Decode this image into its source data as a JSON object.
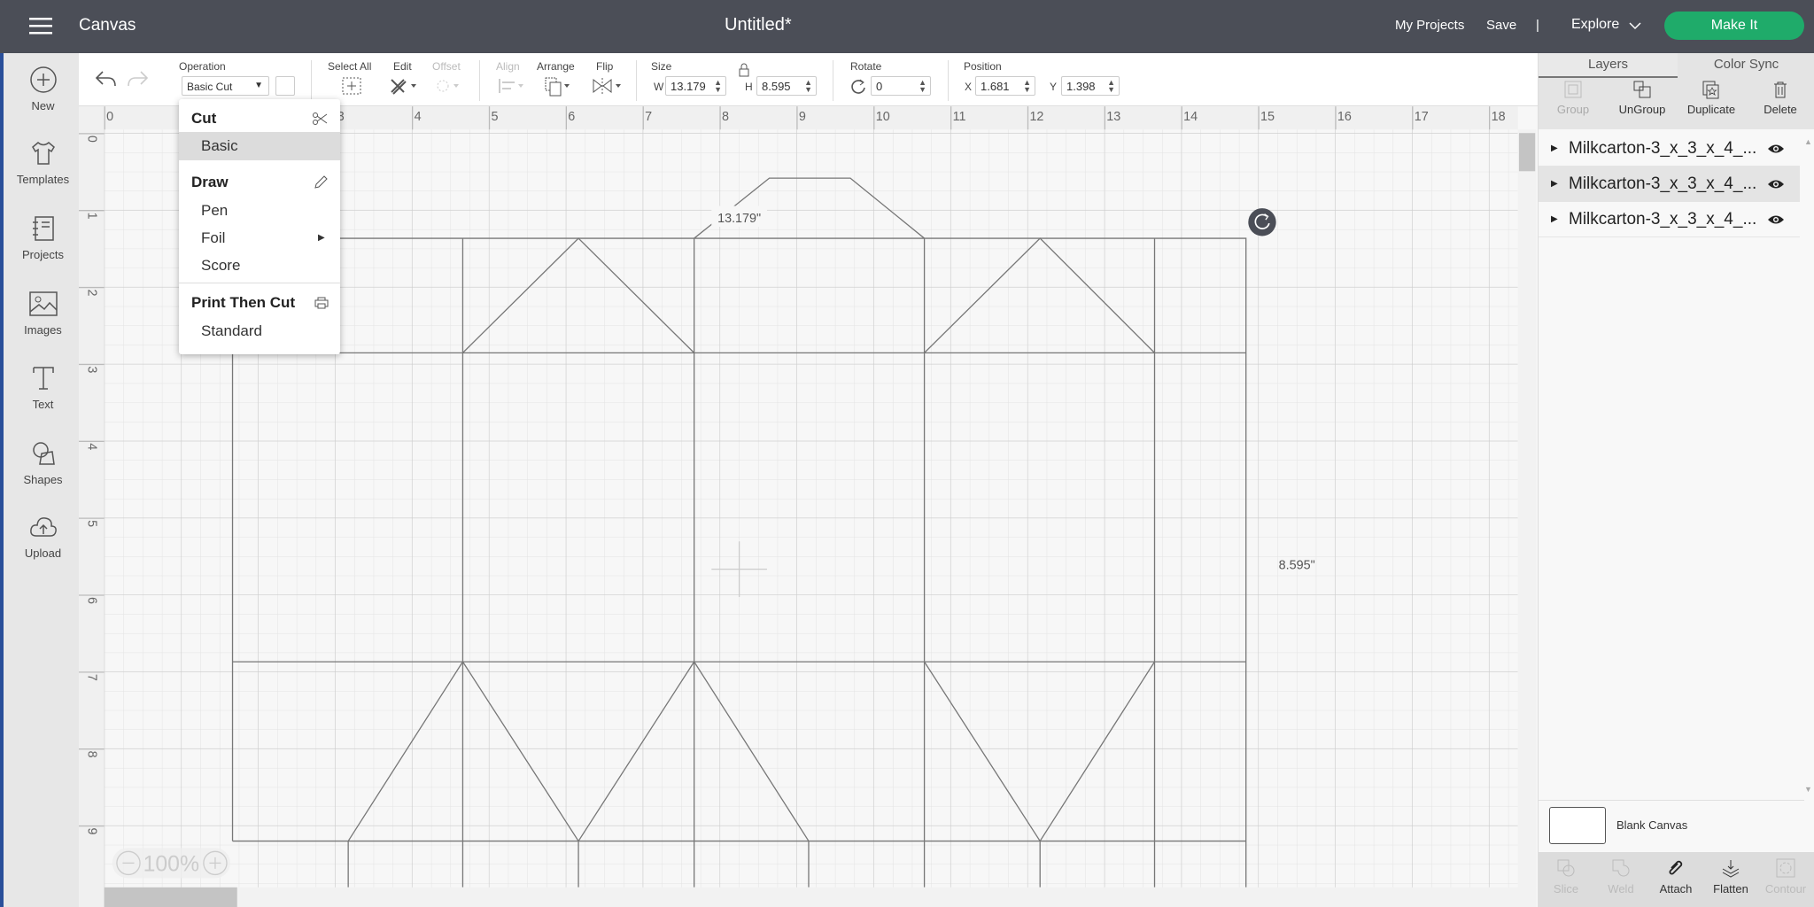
{
  "topbar": {
    "menu_icon": "hamburger-icon",
    "app_title": "Canvas",
    "doc_title": "Untitled*",
    "my_projects": "My Projects",
    "save": "Save",
    "divider": "|",
    "explore": "Explore",
    "make_it": "Make It",
    "make_it_color": "#1fab6a"
  },
  "sidebar": {
    "items": [
      {
        "label": "New",
        "icon": "plus-circle-icon"
      },
      {
        "label": "Templates",
        "icon": "shirt-icon"
      },
      {
        "label": "Projects",
        "icon": "notebook-icon"
      },
      {
        "label": "Images",
        "icon": "image-icon"
      },
      {
        "label": "Text",
        "icon": "text-icon"
      },
      {
        "label": "Shapes",
        "icon": "shapes-icon"
      },
      {
        "label": "Upload",
        "icon": "cloud-upload-icon"
      }
    ]
  },
  "toolbar": {
    "operation_label": "Operation",
    "operation_value": "Basic Cut",
    "select_all": "Select All",
    "edit": "Edit",
    "offset": "Offset",
    "align": "Align",
    "arrange": "Arrange",
    "flip": "Flip",
    "size": "Size",
    "w_label": "W",
    "w_value": "13.179",
    "h_label": "H",
    "h_value": "8.595",
    "rotate": "Rotate",
    "rotate_value": "0",
    "position": "Position",
    "x_label": "X",
    "x_value": "1.681",
    "y_label": "Y",
    "y_value": "1.398"
  },
  "operation_menu": {
    "cut": "Cut",
    "basic": "Basic",
    "draw": "Draw",
    "pen": "Pen",
    "foil": "Foil",
    "score": "Score",
    "print_then_cut": "Print Then Cut",
    "standard": "Standard"
  },
  "ruler": {
    "x": [
      "0",
      "3",
      "4",
      "5",
      "6",
      "7",
      "8",
      "9",
      "10",
      "11",
      "12",
      "13",
      "14",
      "15",
      "16",
      "17",
      "18"
    ],
    "y": [
      "0",
      "1",
      "2",
      "3",
      "4",
      "5",
      "6",
      "7",
      "8",
      "9"
    ]
  },
  "canvas": {
    "width_label": "13.179\"",
    "height_label": "8.595\"",
    "zoom": "100%"
  },
  "right_panel": {
    "tabs": [
      "Layers",
      "Color Sync"
    ],
    "actions": [
      "Group",
      "UnGroup",
      "Duplicate",
      "Delete"
    ],
    "layers": [
      "Milkcarton-3_x_3_x_4_...",
      "Milkcarton-3_x_3_x_4_...",
      "Milkcarton-3_x_3_x_4_..."
    ],
    "blank_canvas": "Blank Canvas",
    "bottom_actions": [
      "Slice",
      "Weld",
      "Attach",
      "Flatten",
      "Contour"
    ]
  }
}
